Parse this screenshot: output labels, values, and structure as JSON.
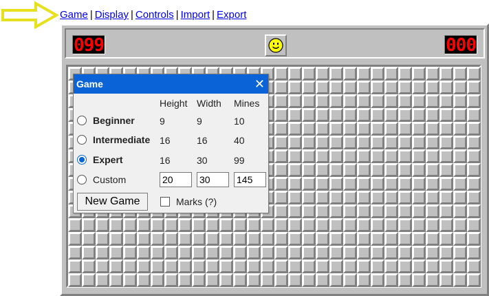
{
  "nav": {
    "items": [
      "Game",
      "Display",
      "Controls",
      "Import",
      "Export"
    ],
    "separator": "|"
  },
  "counters": {
    "mines": "099",
    "timer": "000"
  },
  "face": "smiley-icon",
  "board": {
    "rows": 16,
    "cols": 30
  },
  "dialog": {
    "title": "Game",
    "close": "✕",
    "headers": {
      "height": "Height",
      "width": "Width",
      "mines": "Mines"
    },
    "levels": [
      {
        "label": "Beginner",
        "height": "9",
        "width": "9",
        "mines": "10",
        "checked": false
      },
      {
        "label": "Intermediate",
        "height": "16",
        "width": "16",
        "mines": "40",
        "checked": false
      },
      {
        "label": "Expert",
        "height": "16",
        "width": "30",
        "mines": "99",
        "checked": true
      }
    ],
    "custom": {
      "label": "Custom",
      "height": "20",
      "width": "30",
      "mines": "145",
      "checked": false
    },
    "new_game": "New Game",
    "marks": "Marks (?)"
  },
  "colors": {
    "arrow": "#e6e01e",
    "title_bar": "#0a64d8",
    "counter_digits": "#ff0000"
  }
}
